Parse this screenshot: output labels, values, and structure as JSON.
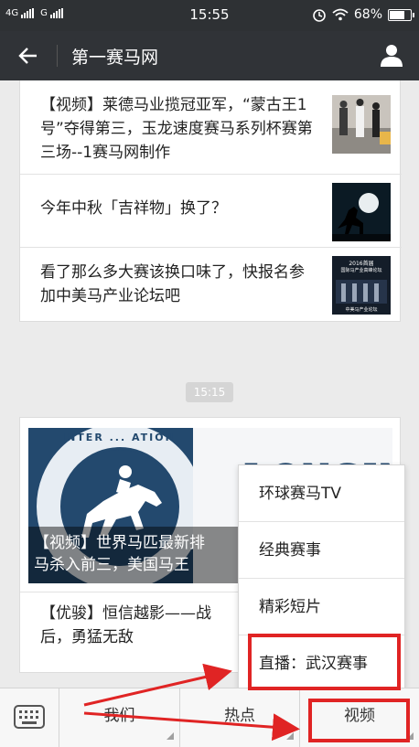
{
  "status_bar": {
    "network1": "4G",
    "network2": "G",
    "time": "15:55",
    "battery": "68%",
    "battery_level": 0.68
  },
  "header": {
    "back_icon": "arrow-left-icon",
    "title": "第一赛马网",
    "profile_icon": "person-icon"
  },
  "articles": [
    {
      "title": "【视频】莱德马业揽冠亚军，“蒙古王1号”夺得第三，玉龙速度赛马系列杯赛第三场--1赛马网制作"
    },
    {
      "title": "今年中秋「吉祥物」换了？"
    },
    {
      "title": "看了那么多大赛该换口味了，快报名参加中美马产业论坛吧"
    }
  ],
  "thumb3_text": {
    "line1": "2016首届",
    "line2": "国际马产业高峰论坛",
    "line3": "中美马产业论坛"
  },
  "timestamp": "15:15",
  "feature": {
    "banner_text": "LONGIN",
    "banner_arc_text": "INTER ... ATION",
    "caption_line1": "【视频】世界马匹最新排",
    "caption_line2": "马杀入前三，美国马王",
    "sub_line1": "【优骏】恒信越影——战",
    "sub_line2": "后，勇猛无敌"
  },
  "popup_menu": {
    "items": [
      "环球赛马TV",
      "经典赛事",
      "精彩短片",
      "直播：武汉赛事"
    ]
  },
  "bottom_bar": {
    "keyboard_icon": "keyboard-icon",
    "tabs": [
      "我们",
      "热点",
      "视频"
    ]
  },
  "colors": {
    "annotation_red": "#e02424",
    "header_bg": "#303337"
  }
}
